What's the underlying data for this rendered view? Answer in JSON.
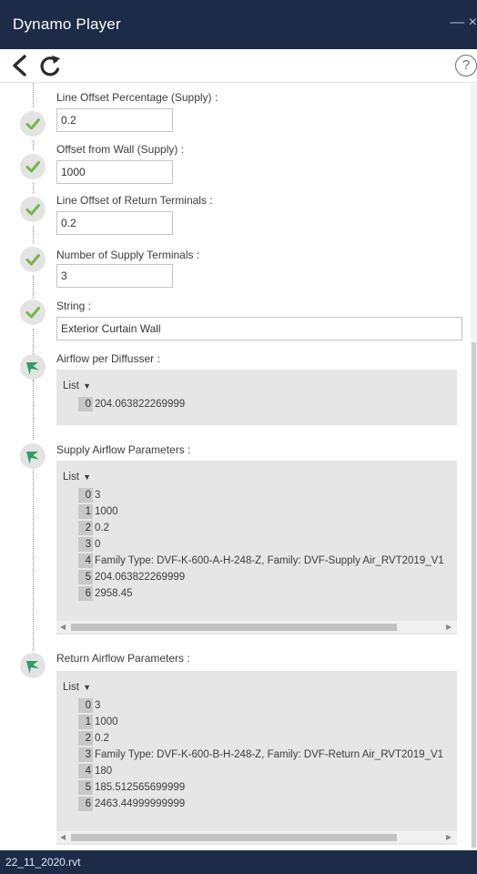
{
  "window": {
    "title": "Dynamo Player",
    "controls": "— ×"
  },
  "toolbar": {
    "back_icon": "chevron-left-icon",
    "refresh_icon": "refresh-icon",
    "help_label": "?"
  },
  "inputs": [
    {
      "label": "Line Offset Percentage (Supply) :",
      "value": "0.2",
      "status": "success"
    },
    {
      "label": "Offset from Wall (Supply) :",
      "value": "1000",
      "status": "success"
    },
    {
      "label": "Line Offset of Return Terminals :",
      "value": "0.2",
      "status": "success"
    },
    {
      "label": "Number of Supply Terminals :",
      "value": "3",
      "status": "success"
    },
    {
      "label": "String :",
      "value": "Exterior Curtain Wall",
      "status": "success"
    }
  ],
  "outputs": [
    {
      "label": "Airflow per Diffusser :",
      "list_label": "List",
      "items": [
        {
          "index": "0",
          "value": "204.063822269999"
        }
      ]
    },
    {
      "label": "Supply Airflow Parameters :",
      "list_label": "List",
      "items": [
        {
          "index": "0",
          "value": "3"
        },
        {
          "index": "1",
          "value": "1000"
        },
        {
          "index": "2",
          "value": "0.2"
        },
        {
          "index": "3",
          "value": "0"
        },
        {
          "index": "4",
          "value": "Family Type: DVF-K-600-A-H-248-Z, Family: DVF-Supply Air_RVT2019_V1"
        },
        {
          "index": "5",
          "value": "204.063822269999"
        },
        {
          "index": "6",
          "value": "2958.45"
        }
      ]
    },
    {
      "label": "Return Airflow Parameters :",
      "list_label": "List",
      "items": [
        {
          "index": "0",
          "value": "3"
        },
        {
          "index": "1",
          "value": "1000"
        },
        {
          "index": "2",
          "value": "0.2"
        },
        {
          "index": "3",
          "value": "Family Type: DVF-K-600-B-H-248-Z, Family: DVF-Return Air_RVT2019_V1"
        },
        {
          "index": "4",
          "value": "180"
        },
        {
          "index": "5",
          "value": "185.512565699999"
        },
        {
          "index": "6",
          "value": "2463.44999999999"
        }
      ]
    }
  ],
  "status_bar": {
    "file_name": "22_11_2020.rvt"
  },
  "colors": {
    "title_bar": "#1d2b48",
    "success": "#74b84a",
    "output_flag": "#2f9e5f",
    "output_bg": "#e6e6e6"
  }
}
